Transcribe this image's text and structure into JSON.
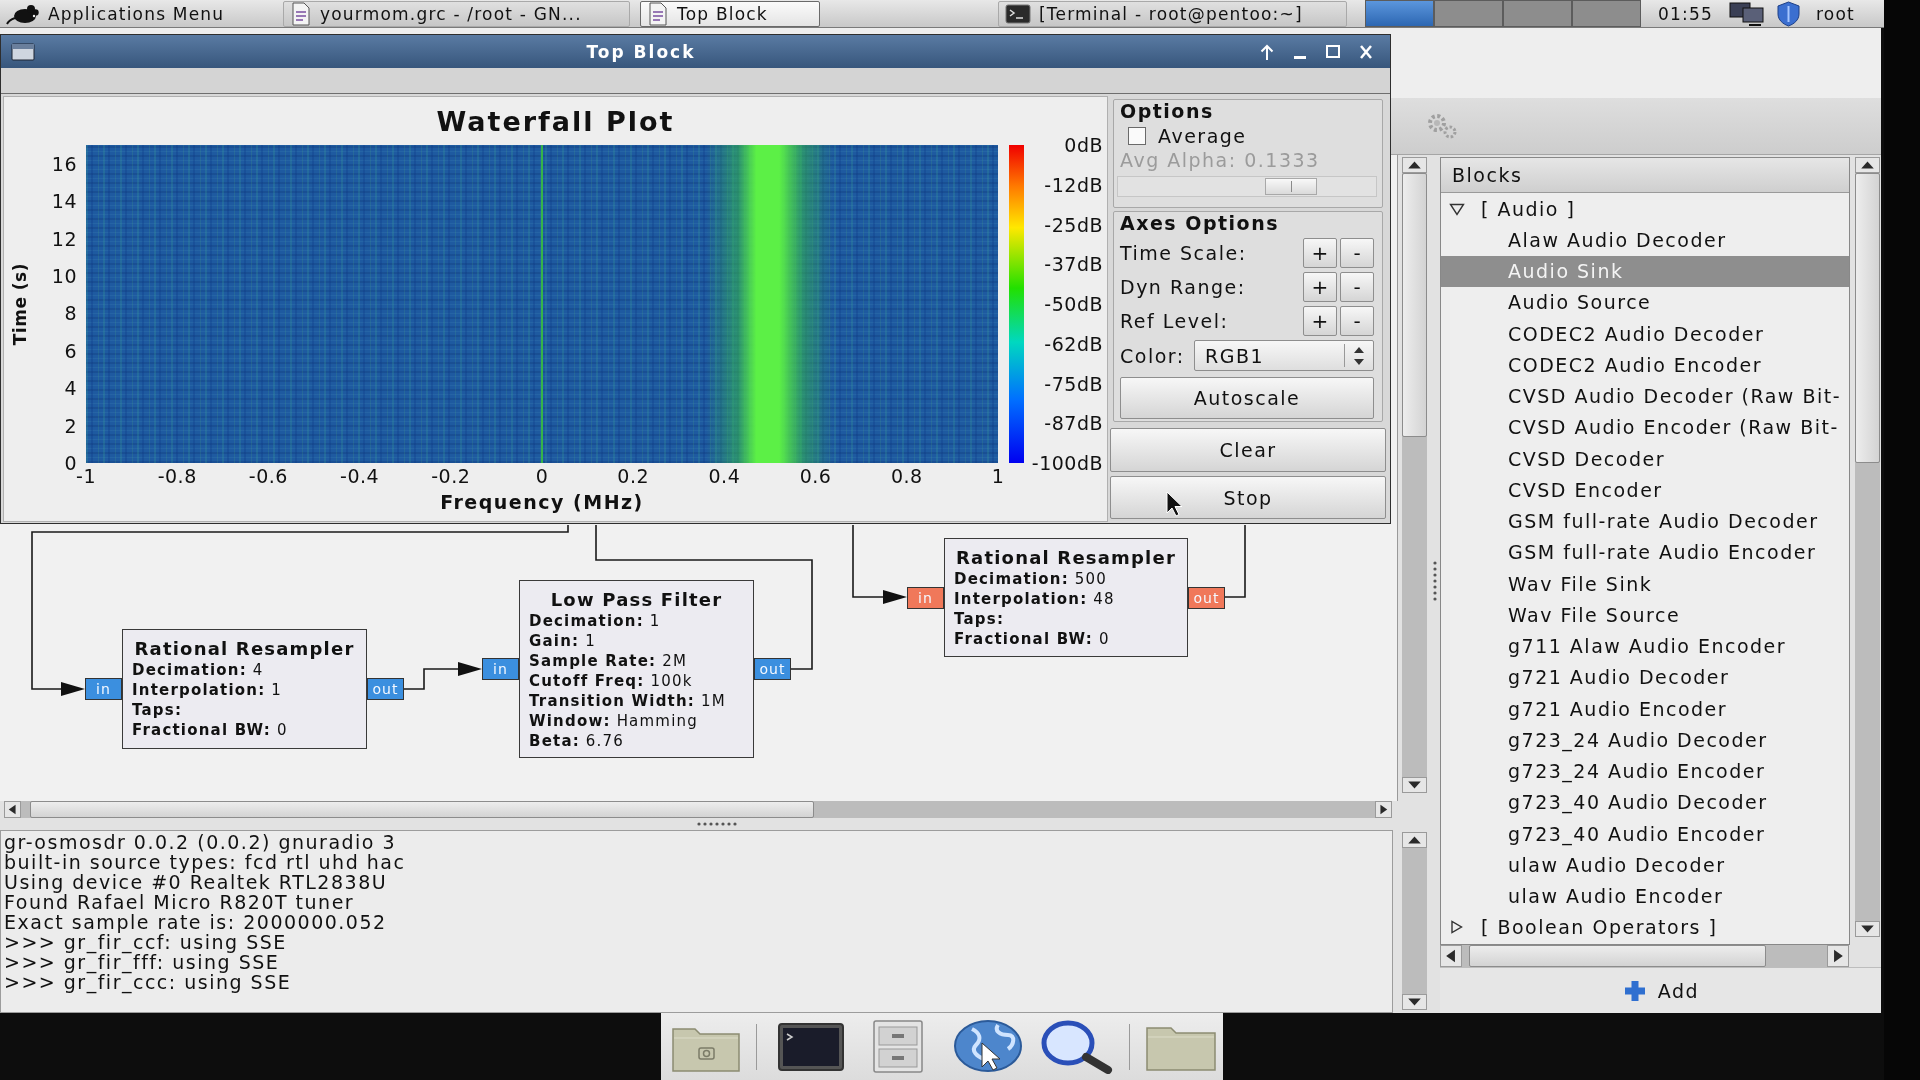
{
  "taskbar": {
    "app_menu": "Applications Menu",
    "tasks": [
      {
        "label": "yourmom.grc - /root - GN...",
        "kind": "document",
        "selected": false
      },
      {
        "label": "Top Block",
        "kind": "document",
        "selected": true
      },
      {
        "label": "[Terminal - root@pentoo:~]",
        "kind": "terminal",
        "selected": false
      }
    ],
    "workspaces": [
      {
        "selected": true
      },
      {
        "selected": false
      },
      {
        "selected": false
      },
      {
        "selected": false
      }
    ],
    "clock": "01:55",
    "user": "root"
  },
  "plot_window": {
    "title": "Top Block",
    "waterfall": {
      "title": "Waterfall Plot",
      "ylabel": "Time (s)",
      "xlabel": "Frequency (MHz)",
      "yticks": [
        "16",
        "14",
        "12",
        "10",
        "8",
        "6",
        "4",
        "2",
        "0"
      ],
      "xticks": [
        "-1",
        "-0.8",
        "-0.6",
        "-0.4",
        "-0.2",
        "0",
        "0.2",
        "0.4",
        "0.6",
        "0.8",
        "1"
      ],
      "colorbar_labels": [
        "0dB",
        "-12dB",
        "-25dB",
        "-37dB",
        "-50dB",
        "-62dB",
        "-75dB",
        "-87dB",
        "-100dB"
      ]
    },
    "options": {
      "title": "Options",
      "average": {
        "label": "Average",
        "checked": false
      },
      "avg_alpha": {
        "label": "Avg Alpha: 0.1333",
        "disabled": true
      },
      "alpha_slider": {
        "level": 0.67,
        "disabled": true
      }
    },
    "axes_options": {
      "title": "Axes Options",
      "steppers": [
        {
          "label": "Time Scale:",
          "buttons": [
            "+",
            "-"
          ]
        },
        {
          "label": "Dyn Range:",
          "buttons": [
            "+",
            "-"
          ]
        },
        {
          "label": "Ref Level:",
          "buttons": [
            "+",
            "-"
          ]
        }
      ],
      "color": {
        "label": "Color:",
        "value": "RGB1"
      },
      "autoscale": "Autoscale"
    },
    "buttons": [
      "Clear",
      "Stop"
    ]
  },
  "flowgraph": {
    "blocks": [
      {
        "title": "Rational Resampler",
        "params": [
          {
            "key": "Decimation:",
            "value": "4"
          },
          {
            "key": "Interpolation:",
            "value": "1"
          },
          {
            "key": "Taps:"
          },
          {
            "key": "Fractional BW:",
            "value": "0"
          }
        ],
        "ports": [
          {
            "label": "in",
            "color": "#3b8fdf"
          },
          {
            "label": "out",
            "color": "#3b8fdf"
          }
        ]
      },
      {
        "title": "Low Pass Filter",
        "params": [
          {
            "key": "Decimation:",
            "value": "1"
          },
          {
            "key": "Gain:",
            "value": "1"
          },
          {
            "key": "Sample Rate:",
            "value": "2M"
          },
          {
            "key": "Cutoff Freq:",
            "value": "100k"
          },
          {
            "key": "Transition Width:",
            "value": "1M"
          },
          {
            "key": "Window:",
            "value": "Hamming"
          },
          {
            "key": "Beta:",
            "value": "6.76"
          }
        ],
        "ports": [
          {
            "label": "in",
            "color": "#3b8fdf"
          },
          {
            "label": "out",
            "color": "#3b8fdf"
          }
        ]
      },
      {
        "title": "Rational Resampler",
        "params": [
          {
            "key": "Decimation:",
            "value": "500"
          },
          {
            "key": "Interpolation:",
            "value": "48"
          },
          {
            "key": "Taps:"
          },
          {
            "key": "Fractional BW:",
            "value": "0"
          }
        ],
        "ports": [
          {
            "label": "in",
            "color": "#f0785a"
          },
          {
            "label": "out",
            "color": "#f0785a"
          }
        ]
      }
    ]
  },
  "console": {
    "lines": [
      "gr-osmosdr 0.0.2 (0.0.2) gnuradio 3",
      "built-in source types: fcd rtl uhd hac",
      "Using device #0 Realtek RTL2838U",
      "Found Rafael Micro R820T tuner",
      "Exact sample rate is: 2000000.052",
      ">>> gr_fir_ccf: using SSE",
      ">>> gr_fir_fff: using SSE",
      ">>> gr_fir_ccc: using SSE"
    ]
  },
  "blocks_panel": {
    "header": "Blocks",
    "tree": [
      {
        "label": "[ Audio ]",
        "expanded": true,
        "selected": false,
        "children": [
          {
            "label": "Alaw Audio Decoder",
            "selected": false
          },
          {
            "label": "Audio Sink",
            "selected": true
          },
          {
            "label": "Audio Source",
            "selected": false
          },
          {
            "label": "CODEC2 Audio Decoder",
            "selected": false
          },
          {
            "label": "CODEC2 Audio Encoder",
            "selected": false
          },
          {
            "label": "CVSD Audio Decoder (Raw Bit-",
            "selected": false
          },
          {
            "label": "CVSD Audio Encoder (Raw Bit-",
            "selected": false
          },
          {
            "label": "CVSD Decoder",
            "selected": false
          },
          {
            "label": "CVSD Encoder",
            "selected": false
          },
          {
            "label": "GSM full-rate Audio Decoder",
            "selected": false
          },
          {
            "label": "GSM full-rate Audio Encoder",
            "selected": false
          },
          {
            "label": "Wav File Sink",
            "selected": false
          },
          {
            "label": "Wav File Source",
            "selected": false
          },
          {
            "label": "g711 Alaw Audio Encoder",
            "selected": false
          },
          {
            "label": "g721 Audio Decoder",
            "selected": false
          },
          {
            "label": "g721 Audio Encoder",
            "selected": false
          },
          {
            "label": "g723_24 Audio Decoder",
            "selected": false
          },
          {
            "label": "g723_24 Audio Encoder",
            "selected": false
          },
          {
            "label": "g723_40 Audio Decoder",
            "selected": false
          },
          {
            "label": "g723_40 Audio Encoder",
            "selected": false
          },
          {
            "label": "ulaw Audio Decoder",
            "selected": false
          },
          {
            "label": "ulaw Audio Encoder",
            "selected": false
          }
        ]
      },
      {
        "label": "[ Boolean Operators ]",
        "expanded": false,
        "selected": false
      }
    ],
    "add_button": "Add"
  }
}
